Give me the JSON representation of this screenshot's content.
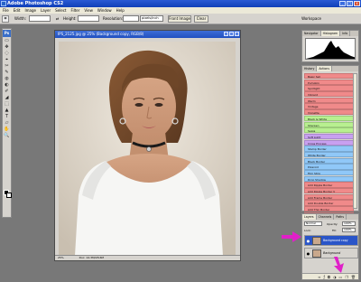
{
  "window": {
    "title": "Adobe Photoshop CS2",
    "controls": [
      "_",
      "□",
      "x"
    ]
  },
  "menu": [
    "File",
    "Edit",
    "Image",
    "Layer",
    "Select",
    "Filter",
    "View",
    "Window",
    "Help"
  ],
  "options": {
    "width_label": "Width:",
    "height_label": "Height:",
    "resolution_label": "Resolution:",
    "units": "pixels/inch",
    "front_image_label": "Front Image",
    "clear_label": "Clear",
    "workspace_label": "Workspace"
  },
  "toolbox": {
    "logo": "Ps",
    "tools": [
      "▭",
      "✥",
      "◌",
      "⌖",
      "✂",
      "✎",
      "◍",
      "◐",
      "✐",
      "◢",
      "⬚",
      "▲",
      "T",
      "▱",
      "✋",
      "🔍"
    ]
  },
  "document": {
    "title": "IPS_2125.jpg @ 25% (Background copy, RGB/8)",
    "zoom": "25%",
    "doc_size": "Doc: 14.3M/28.6M"
  },
  "navigator": {
    "tabs": [
      "Navigator",
      "Histogram",
      "Info"
    ],
    "active_tab": "Histogram"
  },
  "actions": {
    "tabs": [
      "History",
      "Actions"
    ],
    "active_tab": "Actions",
    "items": [
      {
        "label": "Basic Set",
        "color": "#f08a8a"
      },
      {
        "label": "Pumpkin",
        "color": "#f08a8a"
      },
      {
        "label": "Spotlight",
        "color": "#f08a8a"
      },
      {
        "label": "Vibrant",
        "color": "#f08a8a"
      },
      {
        "label": "Warm",
        "color": "#f08a8a"
      },
      {
        "label": "Vintage",
        "color": "#f08a8a"
      },
      {
        "label": "Vignette",
        "color": "#f08a8a"
      },
      {
        "label": "Black & White",
        "color": "#b8f090"
      },
      {
        "label": "Sharpen",
        "color": "#b8f090"
      },
      {
        "label": "Sepia",
        "color": "#b8f090"
      },
      {
        "label": "Soft Light",
        "color": "#c8a0f0"
      },
      {
        "label": "Cross Process",
        "color": "#c8a0f0"
      },
      {
        "label": "Stamp Border",
        "color": "#90c8f8"
      },
      {
        "label": "White Border",
        "color": "#90c8f8"
      },
      {
        "label": "Black Border",
        "color": "#90c8f8"
      },
      {
        "label": "Polaroid",
        "color": "#90c8f8"
      },
      {
        "label": "Film Strip",
        "color": "#90c8f8"
      },
      {
        "label": "Drop Shadow",
        "color": "#90c8f8"
      },
      {
        "label": "Add Ripple Border",
        "color": "#f08a8a"
      },
      {
        "label": "Add Ripple Border V",
        "color": "#f08a8a"
      },
      {
        "label": "Add Frame Border",
        "color": "#f08a8a"
      },
      {
        "label": "Add Double Border",
        "color": "#f08a8a"
      },
      {
        "label": "Add Thin Border",
        "color": "#f08a8a"
      },
      {
        "label": "Convert to sRGB",
        "color": "#f08a8a"
      },
      {
        "label": "Save for Web JPG",
        "color": "#f8e060"
      },
      {
        "label": "Resize to 800px",
        "color": "#f8e060"
      }
    ]
  },
  "layers": {
    "tabs": [
      "Layers",
      "Channels",
      "Paths"
    ],
    "active_tab": "Layers",
    "blend_mode": "Normal",
    "opacity_label": "Opacity:",
    "opacity": "100%",
    "lock_label": "Lock:",
    "fill_label": "Fill:",
    "fill": "100%",
    "items": [
      {
        "name": "Background copy",
        "selected": true
      },
      {
        "name": "Background",
        "selected": false
      }
    ]
  },
  "annotations": {
    "arrow_color": "#e020c8"
  }
}
